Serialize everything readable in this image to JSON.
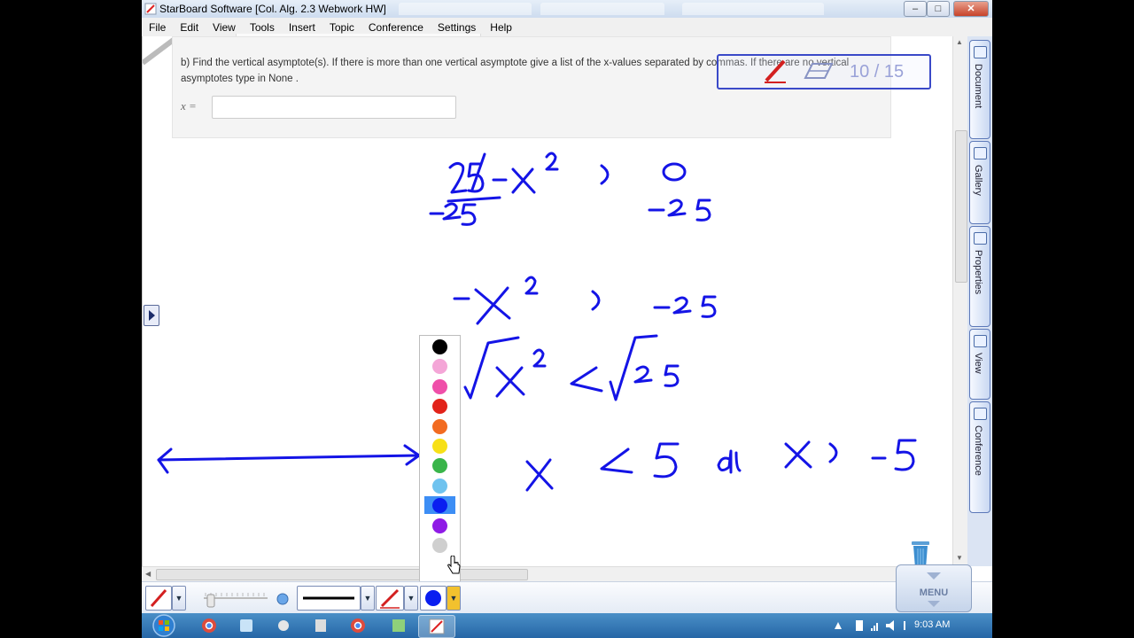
{
  "window": {
    "title": "StarBoard Software [Col. Alg. 2.3 Webwork HW]",
    "controls": {
      "minimize": "–",
      "maximize": "□",
      "close": "✕"
    }
  },
  "menu": [
    "File",
    "Edit",
    "View",
    "Tools",
    "Insert",
    "Topic",
    "Conference",
    "Settings",
    "Help"
  ],
  "question": {
    "text": "b) Find the vertical asymptote(s). If there is more than one vertical asymptote give a list of the x-values separated by commas. If there are no vertical asymptotes type in None .",
    "input_label": "x =",
    "input_value": ""
  },
  "page_indicator": "10 / 15",
  "side_tabs": [
    "Document",
    "Gallery",
    "Properties",
    "View",
    "Conference"
  ],
  "palette": {
    "colors": [
      "#000000",
      "#f4a6d7",
      "#ef4fa9",
      "#e2231a",
      "#f26b21",
      "#f7e017",
      "#3ab54a",
      "#6fc3ef",
      "#0a1ef0",
      "#8f1be6",
      "#cfcfcf"
    ],
    "selected_index": 8
  },
  "handwriting": {
    "ink_color": "#1414e6",
    "lines": [
      "25-x² > 0",
      "-25      -25",
      "-x² > -25",
      "√x² < √25",
      "x < 5  and  x > -5"
    ]
  },
  "menu_button": "MENU",
  "toolbar": {
    "current_color": "#0a1ef0",
    "accent": "#f2c12e"
  },
  "taskbar": {
    "clock": "9:03 AM"
  }
}
